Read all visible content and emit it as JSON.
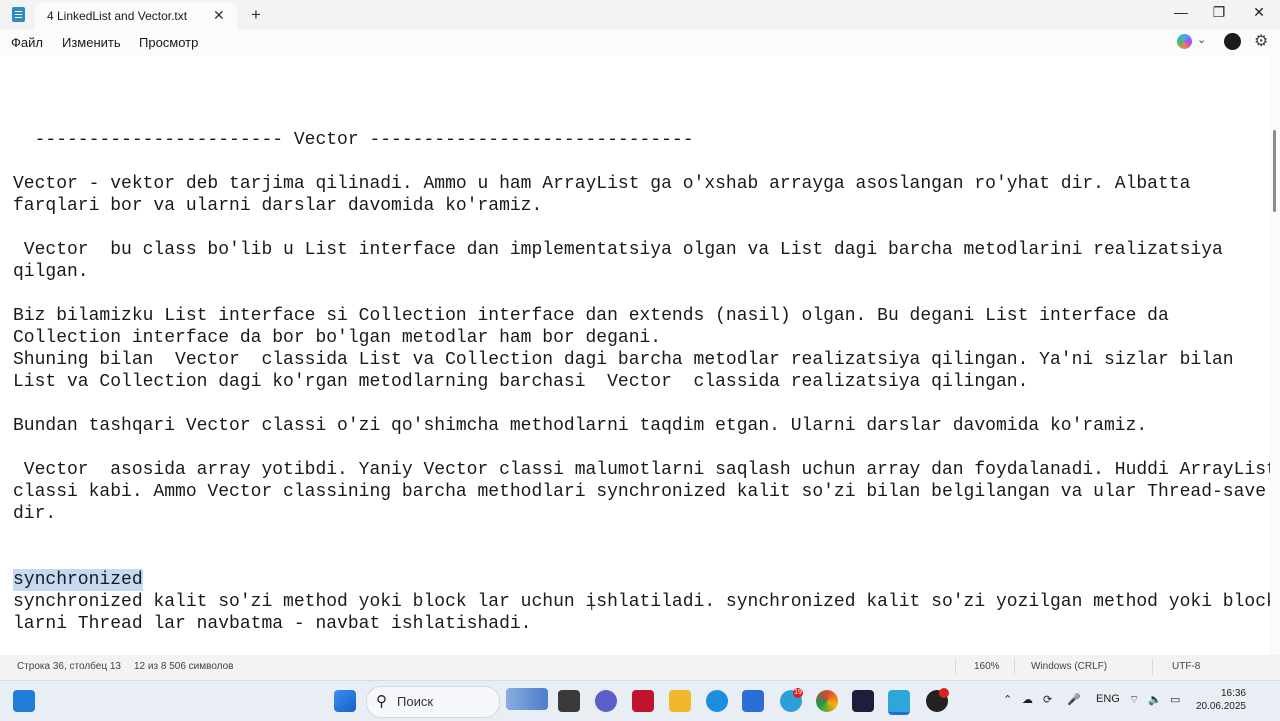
{
  "window": {
    "tab_title": "4 LinkedList and Vector.txt",
    "close_tab": "✕",
    "new_tab": "+",
    "minimize": "—",
    "maximize": "❐",
    "close": "✕"
  },
  "menu": {
    "file": "Файл",
    "edit": "Изменить",
    "view": "Просмотр"
  },
  "editor": {
    "lines": [
      "  ----------------------- Vector ------------------------------",
      "",
      "Vector - vektor deb tarjima qilinadi. Ammo u ham ArrayList ga o'xshab arrayga asoslangan ro'yhat dir. Albatta",
      "farqlari bor va ularni darslar davomida ko'ramiz.",
      "",
      " Vector  bu class bo'lib u List interface dan implementatsiya olgan va List dagi barcha metodlarini realizatsiya",
      "qilgan.",
      "",
      "Biz bilamizku List interface si Collection interface dan extends (nasil) olgan. Bu degani List interface da",
      "Collection interface da bor bo'lgan metodlar ham bor degani.",
      "Shuning bilan  Vector  classida List va Collection dagi barcha metodlar realizatsiya qilingan. Ya'ni sizlar bilan",
      "List va Collection dagi ko'rgan metodlarning barchasi  Vector  classida realizatsiya qilingan.",
      "",
      "Bundan tashqari Vector classi o'zi qo'shimcha methodlarni taqdim etgan. Ularni darslar davomida ko'ramiz.",
      "",
      " Vector  asosida array yotibdi. Yaniy Vector classi malumotlarni saqlash uchun array dan foydalanadi. Huddi ArrayList",
      "classi kabi. Ammo Vector classining barcha methodlari synchronized kalit so'zi bilan belgilangan va ular Thread-save",
      "dir.",
      "",
      "",
      "synchronized",
      "synchronized kalit so'zi method yoki block lar uchun ishlatiladi. synchronized kalit so'zi yozilgan method yoki block",
      "larni Thread lar navbatma - navbat ishlatishadi."
    ],
    "selected_line_index": 20
  },
  "status": {
    "position": "Строка 36, столбец 13",
    "selection": "12 из 8 506 символов",
    "zoom": "160%",
    "line_ending": "Windows (CRLF)",
    "encoding": "UTF-8"
  },
  "taskbar": {
    "search_placeholder": "Поиск",
    "telegram_badge": "19",
    "language": "ENG",
    "time": "16:36",
    "date": "20.06.2025"
  }
}
